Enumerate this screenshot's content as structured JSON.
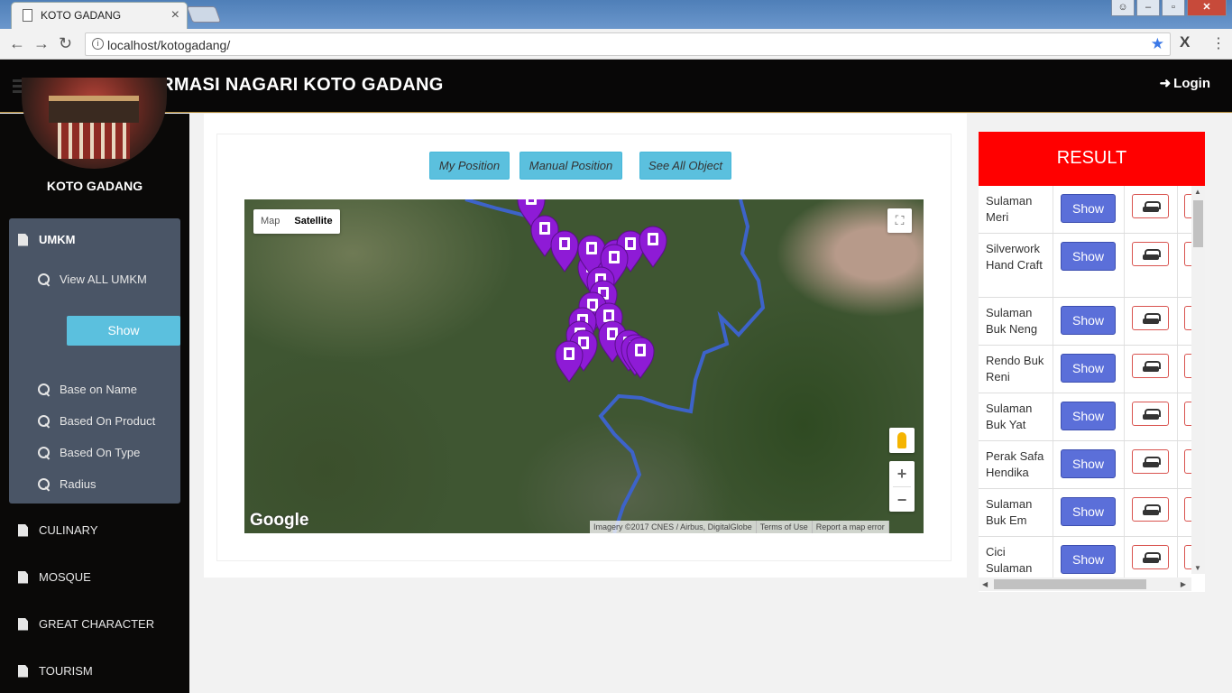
{
  "browser": {
    "tab_title": "KOTO GADANG",
    "url": "localhost/kotogadang/"
  },
  "header": {
    "title": "SISTEM INFORMASI NAGARI KOTO GADANG",
    "login_label": "Login"
  },
  "sidebar": {
    "site_name": "KOTO GADANG",
    "umkm_label": "UMKM",
    "view_all_label": "View ALL UMKM",
    "show_label": "Show",
    "filters": [
      "Base on Name",
      "Based On Product",
      "Based On Type",
      "Radius"
    ],
    "categories": [
      "CULINARY",
      "MOSQUE",
      "GREAT CHARACTER",
      "TOURISM"
    ]
  },
  "map_buttons": {
    "my_position": "My Position",
    "manual_position": "Manual Position",
    "see_all": "See All Object"
  },
  "map": {
    "type_map": "Map",
    "type_satellite": "Satellite",
    "logo": "Google",
    "attribution": "Imagery ©2017 CNES / Airbus, DigitalGlobe",
    "terms": "Terms of Use",
    "report": "Report a map error",
    "marker_color": "#8e1bd6"
  },
  "result": {
    "title": "RESULT",
    "show_label": "Show",
    "items": [
      {
        "name": "Sulaman Meri"
      },
      {
        "name": "Silverwork Hand Craft"
      },
      {
        "name": "Sulaman Buk Neng"
      },
      {
        "name": "Rendo Buk Reni"
      },
      {
        "name": "Sulaman Buk Yat"
      },
      {
        "name": "Perak Safa Hendika"
      },
      {
        "name": "Sulaman Buk Em"
      },
      {
        "name": "Cici Sulaman"
      }
    ]
  },
  "colors": {
    "header_bg": "#080707",
    "result_header": "#ff0000",
    "show_button": "#5b6fd9",
    "info_button": "#5bc0de"
  }
}
